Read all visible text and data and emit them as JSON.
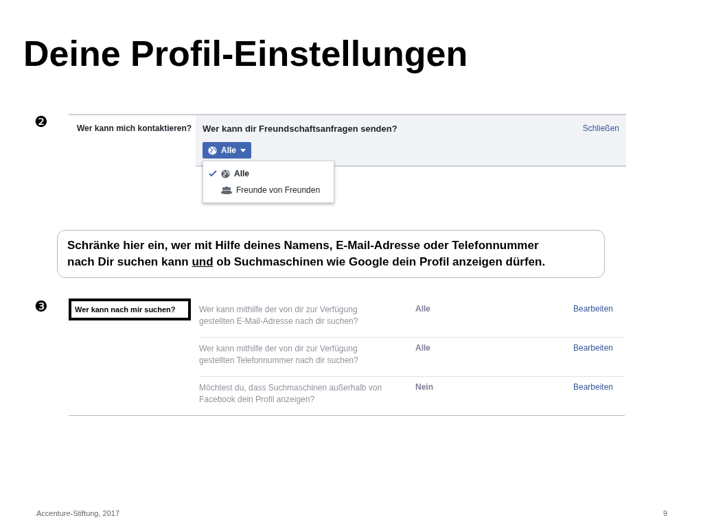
{
  "title": "Deine Profil-Einstellungen",
  "contact_section": {
    "marker": "❷",
    "label": "Wer kann mich kontaktieren?",
    "question": "Wer kann dir Freundschaftsanfragen senden?",
    "close_link": "Schließen",
    "dropdown_button": "Alle",
    "menu": [
      {
        "label": "Alle",
        "selected": true,
        "kind": "public"
      },
      {
        "label": "Freunde von Freunden",
        "selected": false,
        "kind": "friends"
      }
    ]
  },
  "callout": {
    "before": "Schränke hier ein, wer mit Hilfe deines Namens, E-Mail-Adresse oder Telefonnummer nach Dir suchen kann ",
    "underlined": "und",
    "after": " ob Suchmaschinen wie Google dein Profil anzeigen dürfen."
  },
  "search_section": {
    "marker": "❸",
    "label": "Wer kann nach mir suchen?",
    "highlighted": true,
    "rows": [
      {
        "question": "Wer kann mithilfe der von dir zur Verfügung gestellten E-Mail-Adresse nach dir suchen?",
        "value": "Alle",
        "link": "Bearbeiten"
      },
      {
        "question": "Wer kann mithilfe der von dir zur Verfügung gestellten Telefonnummer nach dir suchen?",
        "value": "Alle",
        "link": "Bearbeiten"
      },
      {
        "question": "Möchtest du, dass Suchmaschinen außerhalb von Facebook dein Profil anzeigen?",
        "value": "Nein",
        "link": "Bearbeiten"
      }
    ]
  },
  "footer": {
    "source": "Accenture-Stiftung, 2017",
    "page": "9"
  }
}
